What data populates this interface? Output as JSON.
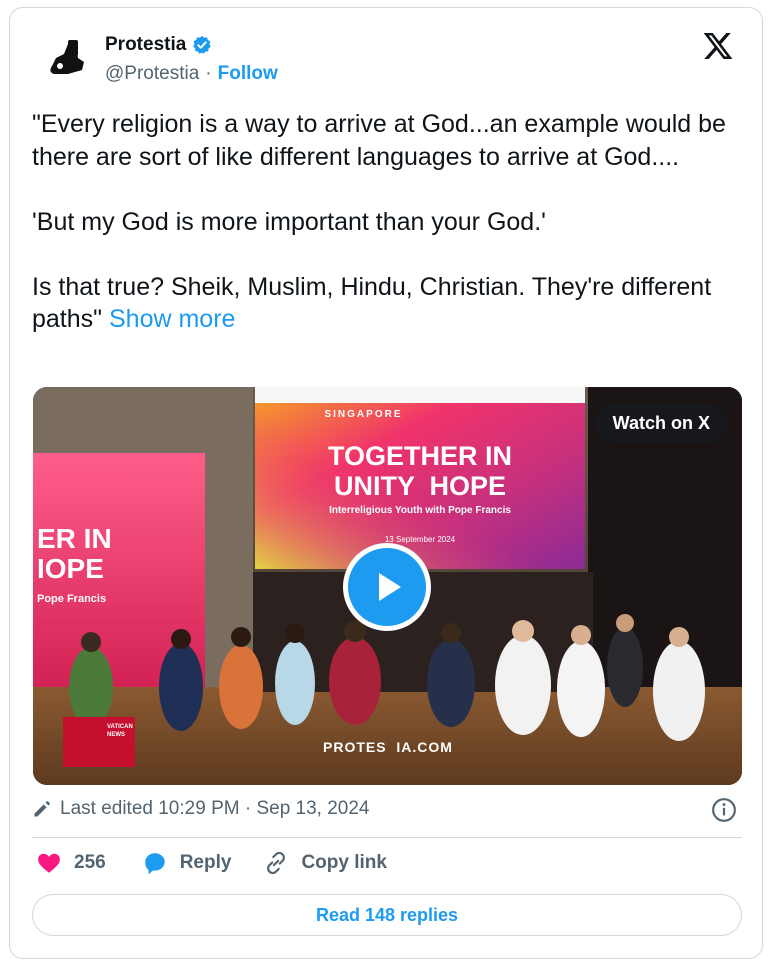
{
  "author": {
    "name": "Protestia",
    "handle": "@Protestia",
    "separator": "·",
    "follow_label": "Follow"
  },
  "tweet": {
    "text": "\"Every religion is a way to arrive at God...an example would be there are sort of like different languages to arrive at God....\n\n'But my God is more important than your God.'\n\nIs that true? Sheik, Muslim, Hindu, Christian. They're different paths\" ",
    "show_more_label": "Show more"
  },
  "media": {
    "watch_label": "Watch on X",
    "banner_top": "SINGAPORE",
    "banner_line1": "TOGETHER IN",
    "banner_line2": "UNITY  HOPE",
    "banner_sub": "Interreligious Youth with Pope Francis",
    "banner_date": "13 September 2024",
    "side_line1": "ER IN",
    "side_line2": "IOPE",
    "side_sub": "Pope Francis",
    "watermark": "PROTES  IA.COM",
    "vatican_news": "VATICAN NEWS"
  },
  "meta": {
    "edited_text": "Last edited 10:29 PM · Sep 13, 2024"
  },
  "actions": {
    "like_count": "256",
    "reply_label": "Reply",
    "copy_link_label": "Copy link"
  },
  "read_replies_label": "Read 148 replies",
  "colors": {
    "accent": "#1d9bf0",
    "like": "#f91880",
    "secondary_text": "#536471",
    "border": "#cfd9de"
  }
}
